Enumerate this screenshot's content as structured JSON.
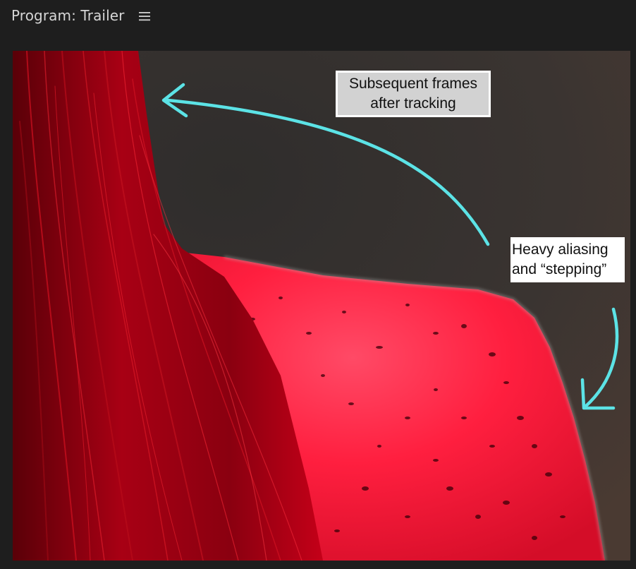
{
  "panel": {
    "title": "Program: Trailer",
    "menu_icon": "hamburger-menu-icon"
  },
  "annotations": {
    "top_line1": "Subsequent frames",
    "top_line2": "after tracking",
    "right_line1": "Heavy aliasing",
    "right_line2": "and “stepping”"
  },
  "colors": {
    "background": "#1e1e1e",
    "arrow": "#5ce3e6",
    "subject_red": "#ff1a3a"
  }
}
